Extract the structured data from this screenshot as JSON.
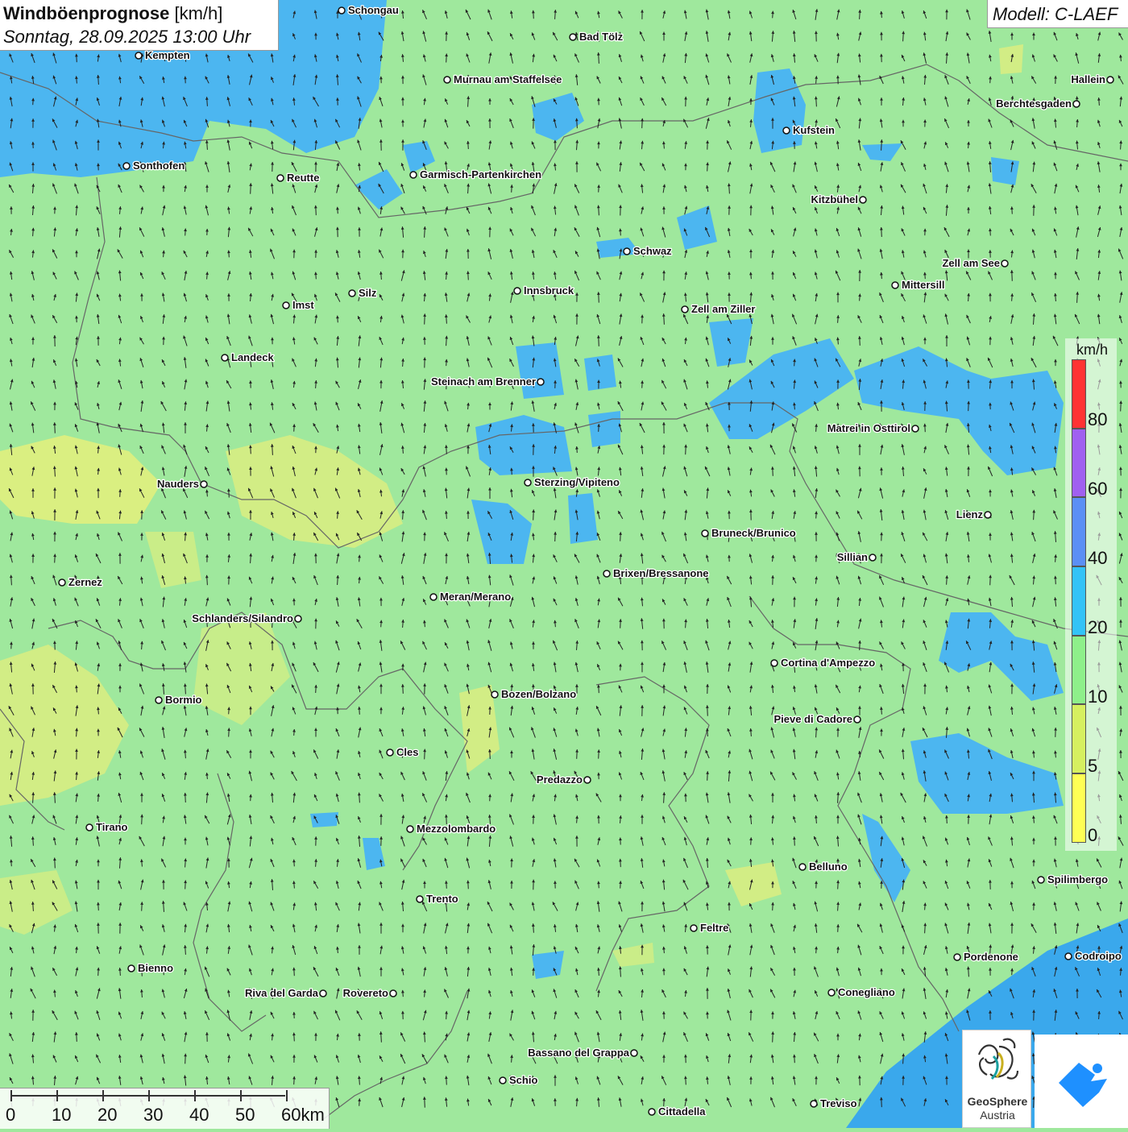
{
  "title": {
    "main": "Windböenprognose",
    "unit": "[km/h]",
    "date": "Sonntag, 28.09.2025 13:00 Uhr"
  },
  "model": "Modell: C-LAEF",
  "legend": {
    "unit": "km/h",
    "ticks": [
      "80",
      "60",
      "40",
      "20",
      "10",
      "5",
      "0"
    ],
    "colors": [
      "#ff3333",
      "#a060f0",
      "#5b8ff5",
      "#33c3f7",
      "#8ef08a",
      "#d6f060",
      "#ffff55"
    ]
  },
  "scale_bar": {
    "labels": [
      "0",
      "10",
      "20",
      "30",
      "40",
      "50",
      "60km"
    ]
  },
  "logos": {
    "geosphere_line1": "GeoSphere",
    "geosphere_line2": "Austria"
  },
  "cities": [
    {
      "name": "Schongau"
    },
    {
      "name": "Bad Tölz"
    },
    {
      "name": "Kempten"
    },
    {
      "name": "Murnau am Staffelsee"
    },
    {
      "name": "Hallein"
    },
    {
      "name": "Berchtesgaden"
    },
    {
      "name": "Kufstein"
    },
    {
      "name": "Sonthofen"
    },
    {
      "name": "Reutte"
    },
    {
      "name": "Garmisch-Partenkirchen"
    },
    {
      "name": "Kitzbühel"
    },
    {
      "name": "Schwaz"
    },
    {
      "name": "Zell am See"
    },
    {
      "name": "Mittersill"
    },
    {
      "name": "Silz"
    },
    {
      "name": "Innsbruck"
    },
    {
      "name": "Imst"
    },
    {
      "name": "Zell am Ziller"
    },
    {
      "name": "Landeck"
    },
    {
      "name": "Steinach am Brenner"
    },
    {
      "name": "Matrei in Osttirol"
    },
    {
      "name": "Nauders"
    },
    {
      "name": "Sterzing/Vipiteno"
    },
    {
      "name": "Lienz"
    },
    {
      "name": "Bruneck/Brunico"
    },
    {
      "name": "Sillian"
    },
    {
      "name": "Zernez"
    },
    {
      "name": "Brixen/Bressanone"
    },
    {
      "name": "Meran/Merano"
    },
    {
      "name": "Schlanders/Silandro"
    },
    {
      "name": "Cortina d'Ampezzo"
    },
    {
      "name": "Bozen/Bolzano"
    },
    {
      "name": "Bormio"
    },
    {
      "name": "Pieve di Cadore"
    },
    {
      "name": "Cles"
    },
    {
      "name": "Predazzo"
    },
    {
      "name": "Tirano"
    },
    {
      "name": "Mezzolombardo"
    },
    {
      "name": "Belluno"
    },
    {
      "name": "Spilimbergo"
    },
    {
      "name": "Trento"
    },
    {
      "name": "Feltre"
    },
    {
      "name": "Pordenone"
    },
    {
      "name": "Codroipo"
    },
    {
      "name": "Bienno"
    },
    {
      "name": "Riva del Garda"
    },
    {
      "name": "Rovereto"
    },
    {
      "name": "Conegliano"
    },
    {
      "name": "Bassano del Grappa"
    },
    {
      "name": "Schio"
    },
    {
      "name": "Treviso"
    },
    {
      "name": "Cittadella"
    }
  ],
  "colors": {
    "background_green": "#9fe89d",
    "light_green": "#b6ef9f",
    "yellow": "#e8f07a",
    "blue": "#4cb6f0",
    "sea_blue": "#3aa8ec"
  }
}
